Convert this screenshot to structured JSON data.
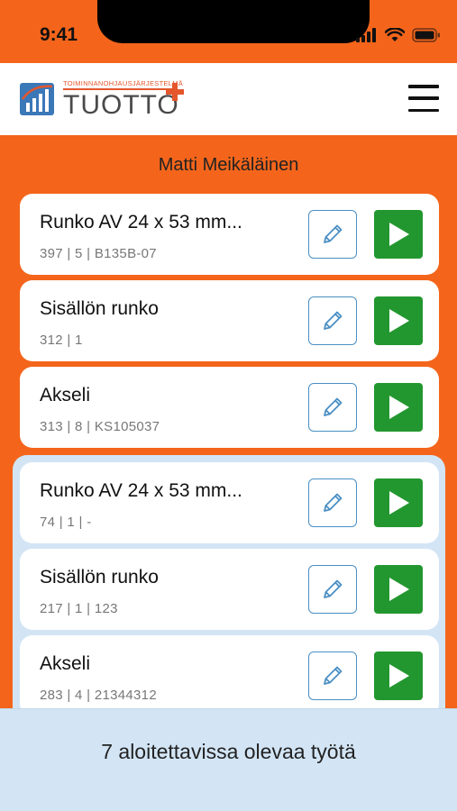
{
  "status": {
    "time": "9:41"
  },
  "header": {
    "logo_small": "TOIMINNANOHJAUSJÄRJESTELMÄ",
    "logo_text": "TUOTTO"
  },
  "user_name": "Matti Meikäläinen",
  "jobs": [
    {
      "title": "Runko AV 24 x 53 mm...",
      "meta": "397  |  5  |  B135B-07"
    },
    {
      "title": "Sisällön runko",
      "meta": "312  |  1"
    },
    {
      "title": "Akseli",
      "meta": "313  |  8  |  KS105037"
    },
    {
      "title": "Runko AV 24 x 53 mm...",
      "meta": "74  |  1  |  -"
    },
    {
      "title": "Sisällön runko",
      "meta": "217  |  1  |  123"
    },
    {
      "title": "Akseli",
      "meta": "283  |  4  |  21344312"
    }
  ],
  "footer": {
    "available_text": "7 aloitettavissa olevaa työtä"
  },
  "icons": {
    "edit": "pencil-icon",
    "start": "play-icon",
    "menu": "hamburger-menu-icon"
  },
  "colors": {
    "brand_orange": "#f4651b",
    "play_green": "#23972f",
    "edit_blue": "#4a8fc4",
    "panel_blue": "#d3e5f5"
  }
}
